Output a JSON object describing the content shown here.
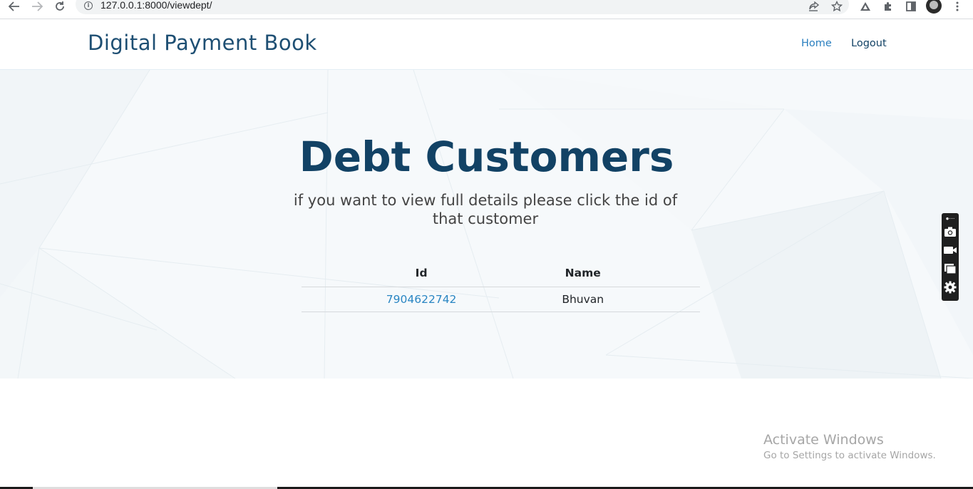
{
  "browser": {
    "url": "127.0.0.1:8000/viewdept/",
    "icons": {
      "back": "arrow-left-icon",
      "forward": "arrow-right-icon",
      "reload": "reload-icon",
      "site_info": "info-icon",
      "share": "share-icon",
      "bookmark": "star-icon",
      "extension_a": "triangle-extension-icon",
      "extensions": "puzzle-icon",
      "side_panel": "side-panel-icon",
      "profile": "avatar-icon",
      "menu": "kebab-menu-icon"
    }
  },
  "header": {
    "brand": "Digital Payment Book",
    "nav": [
      {
        "label": "Home",
        "color": "#2a7fbf"
      },
      {
        "label": "Logout",
        "color": "#124265"
      }
    ]
  },
  "hero": {
    "title": "Debt Customers",
    "subtitle": "if you want to view full details please click the id of that customer",
    "title_color": "#124265"
  },
  "table": {
    "columns": [
      "Id",
      "Name"
    ],
    "rows": [
      {
        "id": "7904622742",
        "name": "Bhuvan"
      }
    ],
    "link_color": "#2a86c3"
  },
  "capture_toolbar": {
    "icons": [
      "camera-icon",
      "video-icon",
      "window-icon",
      "gear-icon"
    ]
  },
  "watermark": {
    "title": "Activate Windows",
    "subtitle": "Go to Settings to activate Windows."
  }
}
